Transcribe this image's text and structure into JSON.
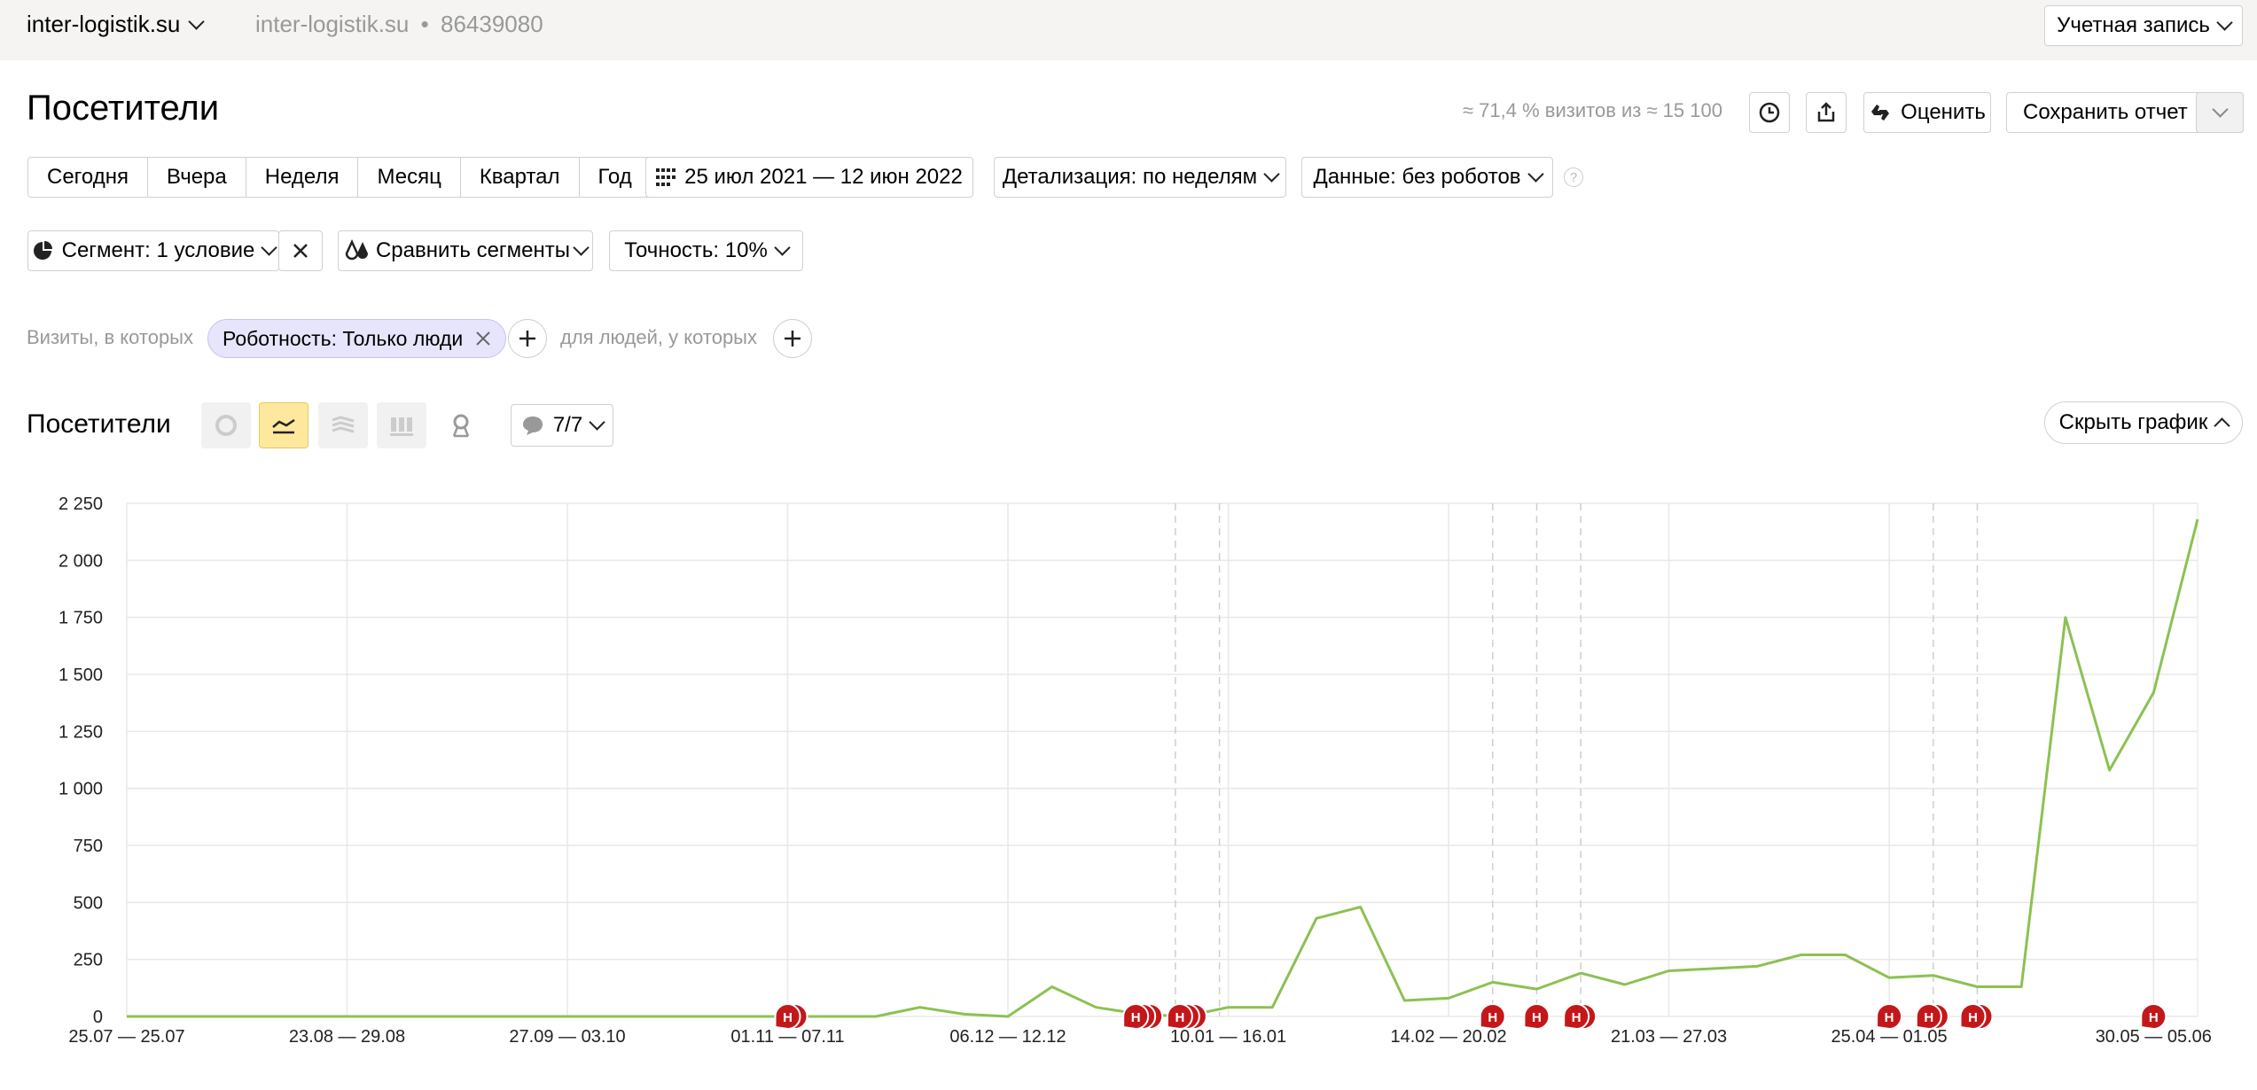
{
  "header": {
    "site": "inter-logistik.su",
    "counter_site": "inter-logistik.su",
    "counter_sep": "•",
    "counter_id": "86439080",
    "account": "Учетная запись"
  },
  "page": {
    "title": "Посетители",
    "sample_stat": "≈ 71,4 % визитов из ≈ 15 100",
    "rate_label": "Оценить",
    "save_label": "Сохранить отчет"
  },
  "periods": [
    "Сегодня",
    "Вчера",
    "Неделя",
    "Месяц",
    "Квартал",
    "Год"
  ],
  "date_range": "25 июл 2021 — 12 июн 2022",
  "detail": "Детализация: по неделям",
  "data_filter": "Данные: без роботов",
  "help": "?",
  "segment": {
    "label": "Сегмент: 1 условие",
    "compare": "Сравнить сегменты",
    "accuracy": "Точность: 10%"
  },
  "filters": {
    "visits_prefix": "Визиты, в которых",
    "condition": "Роботность: Только люди",
    "people_prefix": "для людей, у которых"
  },
  "chart_section": {
    "title": "Посетители",
    "annotations": "7/7",
    "hide": "Скрыть график",
    "marker_letter": "Н"
  },
  "colors": {
    "line": "#8cc152",
    "marker": "#c4171a",
    "active_view": "#fde89d"
  },
  "chart_data": {
    "type": "line",
    "y_ticks": [
      "0",
      "250",
      "500",
      "750",
      "1 000",
      "1 250",
      "1 500",
      "1 750",
      "2 000",
      "2 250"
    ],
    "ylim": [
      0,
      2250
    ],
    "x_tick_labels": [
      "25.07 — 25.07",
      "23.08 — 29.08",
      "27.09 — 03.10",
      "01.11 — 07.11",
      "06.12 — 12.12",
      "10.01 — 16.01",
      "14.02 — 20.02",
      "21.03 — 27.03",
      "25.04 — 01.05",
      "30.05 — 05.06"
    ],
    "x_tick_indices": [
      0,
      5,
      10,
      15,
      20,
      25,
      30,
      35,
      40,
      46
    ],
    "series": [
      {
        "values": [
          0,
          0,
          0,
          0,
          0,
          0,
          0,
          0,
          0,
          0,
          0,
          0,
          0,
          0,
          0,
          0,
          0,
          0,
          40,
          10,
          0,
          130,
          40,
          10,
          0,
          40,
          40,
          430,
          480,
          70,
          80,
          150,
          120,
          190,
          140,
          200,
          210,
          220,
          270,
          270,
          170,
          180,
          130,
          130,
          1750,
          1080,
          1420,
          2180
        ]
      }
    ],
    "dashed_x": [
      23.8,
      24.8,
      31,
      32,
      33,
      41,
      42
    ],
    "markers": [
      {
        "x": 15,
        "count": 2
      },
      {
        "x": 22.9,
        "count": 3
      },
      {
        "x": 23.9,
        "count": 3
      },
      {
        "x": 31,
        "count": 1
      },
      {
        "x": 32,
        "count": 1
      },
      {
        "x": 32.9,
        "count": 2
      },
      {
        "x": 40,
        "count": 1
      },
      {
        "x": 40.9,
        "count": 2
      },
      {
        "x": 41.9,
        "count": 2
      },
      {
        "x": 46,
        "count": 1
      }
    ],
    "grid": true
  }
}
